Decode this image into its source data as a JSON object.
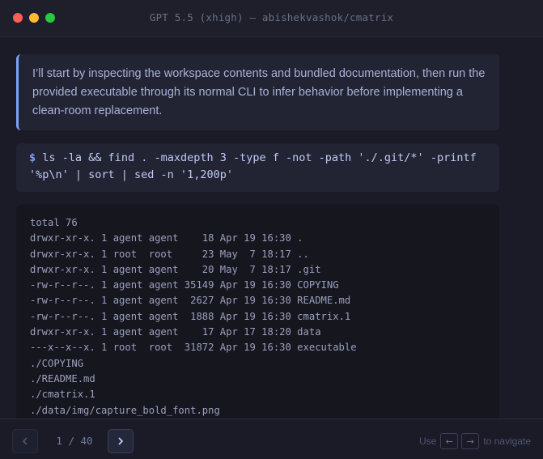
{
  "window": {
    "title": "GPT 5.5 (xhigh) — abishekvashok/cmatrix",
    "colors": {
      "close": "#ff5f57",
      "minimize": "#febc2e",
      "maximize": "#28c840",
      "accent": "#7aa2f7"
    }
  },
  "message": {
    "lines": [
      "I’ll start by inspecting the workspace contents and bundled documentation, then run the",
      "provided executable through its normal CLI to infer behavior before implementing a",
      "clean-room replacement."
    ]
  },
  "command": {
    "prompt": "$",
    "text": "ls -la && find . -maxdepth 3 -type f -not -path './.git/*' -printf '%p\\n' | sort | sed -n '1,200p'"
  },
  "output": {
    "lines": [
      "total 76",
      "drwxr-xr-x. 1 agent agent    18 Apr 19 16:30 .",
      "drwxr-xr-x. 1 root  root     23 May  7 18:17 ..",
      "drwxr-xr-x. 1 agent agent    20 May  7 18:17 .git",
      "-rw-r--r--. 1 agent agent 35149 Apr 19 16:30 COPYING",
      "-rw-r--r--. 1 agent agent  2627 Apr 19 16:30 README.md",
      "-rw-r--r--. 1 agent agent  1888 Apr 19 16:30 cmatrix.1",
      "drwxr-xr-x. 1 agent agent    17 Apr 17 18:20 data",
      "---x--x--x. 1 root  root  31872 Apr 19 16:30 executable",
      "./COPYING",
      "./README.md",
      "./cmatrix.1",
      "./data/img/capture_bold_font.png"
    ]
  },
  "footer": {
    "page_counter": "1 / 40",
    "prev_icon": "chevron-left-icon",
    "next_icon": "chevron-right-icon",
    "hint_use": "Use",
    "hint_key_left": "←",
    "hint_key_right": "→",
    "hint_navigate": "to navigate"
  }
}
